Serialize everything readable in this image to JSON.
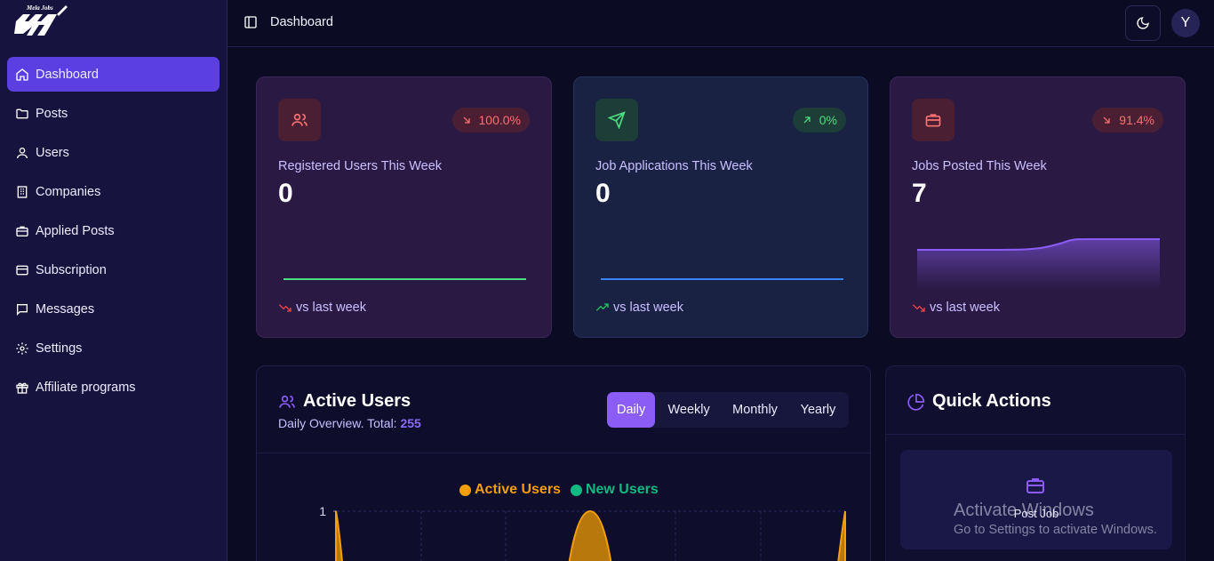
{
  "app": {
    "logo_text": "Mela Jobs"
  },
  "sidebar": {
    "items": [
      {
        "label": "Dashboard",
        "icon": "home-icon",
        "active": true
      },
      {
        "label": "Posts",
        "icon": "folder-icon"
      },
      {
        "label": "Users",
        "icon": "user-icon"
      },
      {
        "label": "Companies",
        "icon": "building-icon"
      },
      {
        "label": "Applied Posts",
        "icon": "briefcase-icon"
      },
      {
        "label": "Subscription",
        "icon": "credit-card-icon"
      },
      {
        "label": "Messages",
        "icon": "message-icon"
      },
      {
        "label": "Settings",
        "icon": "gear-icon"
      },
      {
        "label": "Affiliate programs",
        "icon": "gift-icon"
      }
    ]
  },
  "header": {
    "breadcrumb": "Dashboard",
    "avatar_initial": "Y"
  },
  "stats": [
    {
      "label": "Registered Users This Week",
      "value": "0",
      "change": "100.0%",
      "trend": "down",
      "footer": "vs last week",
      "color": "#ef4444",
      "line_color": "#4ade80",
      "series": [
        0,
        0,
        0,
        0,
        0,
        0,
        0
      ]
    },
    {
      "label": "Job Applications This Week",
      "value": "0",
      "change": "0%",
      "trend": "up",
      "footer": "vs last week",
      "color": "#22c55e",
      "line_color": "#3b82f6",
      "series": [
        0,
        0,
        0,
        0,
        0,
        0,
        0
      ]
    },
    {
      "label": "Jobs Posted This Week",
      "value": "7",
      "change": "91.4%",
      "trend": "down",
      "footer": "vs last week",
      "color": "#ef4444",
      "line_color": "#8b5cf6",
      "series": [
        0,
        0,
        0,
        0,
        1,
        1,
        1
      ]
    }
  ],
  "active_users": {
    "title": "Active Users",
    "subtitle_prefix": "Daily Overview. Total:",
    "total": "255",
    "tabs": [
      "Daily",
      "Weekly",
      "Monthly",
      "Yearly"
    ],
    "active_tab": "Daily"
  },
  "chart_data": {
    "type": "area",
    "series": [
      {
        "name": "Active Users",
        "color": "#f59e0b"
      },
      {
        "name": "New Users",
        "color": "#10b981"
      }
    ],
    "ytick_labels": [
      "1"
    ],
    "grid": true,
    "legend": "top-center"
  },
  "quick_actions": {
    "title": "Quick Actions",
    "items": [
      {
        "label": "Post Job",
        "icon": "briefcase-icon"
      }
    ]
  },
  "watermark": {
    "line1": "Activate Windows",
    "line2": "Go to Settings to activate Windows."
  }
}
